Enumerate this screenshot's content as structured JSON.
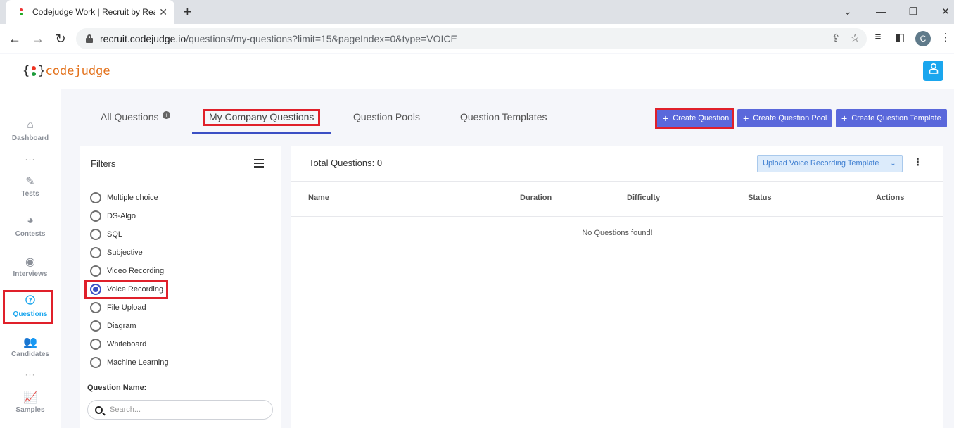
{
  "browser": {
    "tab_title": "Codejudge Work | Recruit by Rea",
    "tab_close": "✕",
    "new_tab": "+",
    "url_host": "recruit.codejudge.io",
    "url_path": "/questions/my-questions?limit=15&pageIndex=0&type=VOICE",
    "profile_initial": "C"
  },
  "header": {
    "logo_open": "{",
    "logo_close": "}",
    "logo_text": "codejudge"
  },
  "sidebar": {
    "items": [
      {
        "label": "Dashboard",
        "icon": "home-icon"
      },
      {
        "label": "Tests",
        "icon": "pencil-icon"
      },
      {
        "label": "Contests",
        "icon": "pie-icon"
      },
      {
        "label": "Interviews",
        "icon": "podcast-icon"
      },
      {
        "label": "Questions",
        "icon": "question-icon",
        "active": true
      },
      {
        "label": "Candidates",
        "icon": "users-icon"
      },
      {
        "label": "Samples",
        "icon": "chart-icon"
      }
    ]
  },
  "tabs": [
    {
      "label": "All Questions"
    },
    {
      "label": "My Company Questions",
      "active": true
    },
    {
      "label": "Question Pools"
    },
    {
      "label": "Question Templates"
    }
  ],
  "actions": {
    "create_question": "Create Question",
    "create_pool": "Create Question Pool",
    "create_template": "Create Question Template"
  },
  "filters": {
    "title": "Filters",
    "options": [
      {
        "label": "Multiple choice",
        "checked": false
      },
      {
        "label": "DS-Algo",
        "checked": false
      },
      {
        "label": "SQL",
        "checked": false
      },
      {
        "label": "Subjective",
        "checked": false
      },
      {
        "label": "Video Recording",
        "checked": false
      },
      {
        "label": "Voice Recording",
        "checked": true
      },
      {
        "label": "File Upload",
        "checked": false
      },
      {
        "label": "Diagram",
        "checked": false
      },
      {
        "label": "Whiteboard",
        "checked": false
      },
      {
        "label": "Machine Learning",
        "checked": false
      }
    ],
    "question_name_label": "Question Name:",
    "search_placeholder": "Search..."
  },
  "results": {
    "total": "Total Questions: 0",
    "upload_label": "Upload Voice Recording Template",
    "columns": [
      "Name",
      "Duration",
      "Difficulty",
      "Status",
      "Actions"
    ],
    "empty": "No Questions found!"
  },
  "colors": {
    "accent": "#5a68db",
    "highlight": "#e0202a",
    "active_sidebar": "#1aa6ee"
  }
}
